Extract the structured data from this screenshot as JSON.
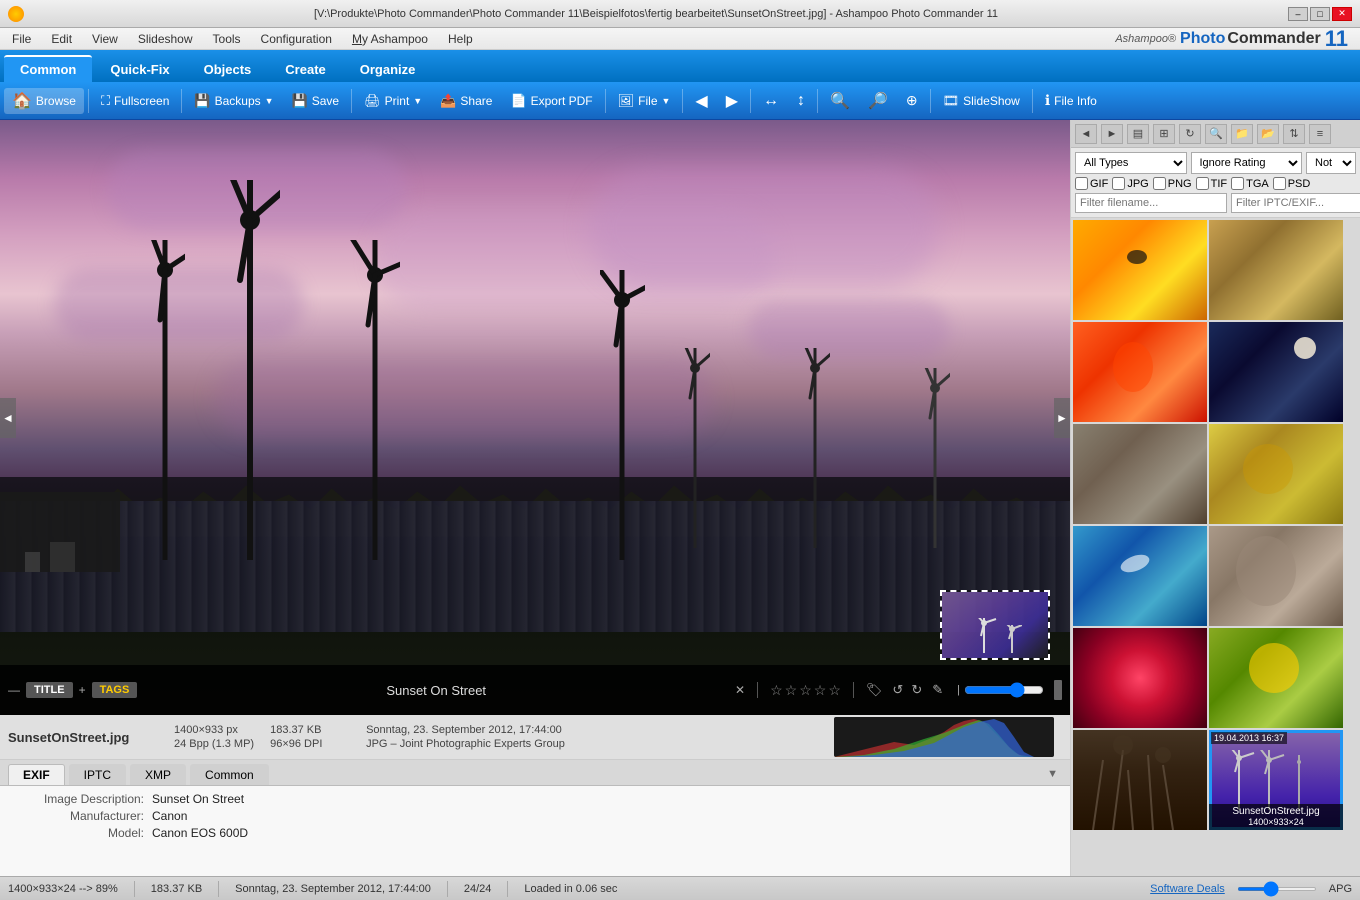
{
  "titlebar": {
    "title": "[V:\\Produkte\\Photo Commander\\Photo Commander 11\\Beispielfotos\\fertig bearbeitet\\SunsetOnStreet.jpg] - Ashampoo Photo Commander 11",
    "min": "–",
    "max": "□",
    "close": "✕"
  },
  "menubar": {
    "items": [
      "File",
      "Edit",
      "View",
      "Slideshow",
      "Tools",
      "Configuration",
      "My Ashampoo",
      "Help"
    ]
  },
  "tabs": {
    "items": [
      "Common",
      "Quick-Fix",
      "Objects",
      "Create",
      "Organize"
    ],
    "active": "Common"
  },
  "toolbar": {
    "browse": "Browse",
    "fullscreen": "Fullscreen",
    "backups": "Backups",
    "save": "Save",
    "print": "Print",
    "share": "Share",
    "exportpdf": "Export PDF",
    "file": "File",
    "prev": "◄",
    "next": "►",
    "slideshow": "SlideShow",
    "fileinfo": "File Info"
  },
  "image": {
    "title": "Sunset On Street",
    "filename": "SunsetOnStreet.jpg"
  },
  "file_info": {
    "name": "SunsetOnStreet.jpg",
    "dimensions": "1400×933 px",
    "bits": "24 Bpp (1.3 MP)",
    "dpi": "96×96 DPI",
    "size": "183.37 KB",
    "date": "Sonntag, 23. September 2012, 17:44:00",
    "format": "JPG – Joint Photographic Experts Group"
  },
  "exif_tabs": [
    "EXIF",
    "IPTC",
    "XMP",
    "Common"
  ],
  "exif_data": [
    {
      "label": "Image Description:",
      "value": "Sunset On Street"
    },
    {
      "label": "Manufacturer:",
      "value": "Canon"
    },
    {
      "label": "Model:",
      "value": "Canon EOS 600D"
    }
  ],
  "right_panel": {
    "filter_types": "All Types",
    "filter_rating": "Ignore Rating",
    "filter_third": "Not o",
    "checkboxes": [
      "GIF",
      "JPG",
      "PNG",
      "TIF",
      "TGA",
      "PSD"
    ],
    "placeholder_filename": "Filter filename...",
    "placeholder_iptc": "Filter IPTC/EXIF..."
  },
  "thumbnails": [
    {
      "id": 1,
      "cls": "thumb-bee",
      "label": ""
    },
    {
      "id": 2,
      "cls": "thumb-wheat",
      "label": ""
    },
    {
      "id": 3,
      "cls": "thumb-flower",
      "label": ""
    },
    {
      "id": 4,
      "cls": "thumb-moon",
      "label": ""
    },
    {
      "id": 5,
      "cls": "thumb-mushroom",
      "label": ""
    },
    {
      "id": 6,
      "cls": "thumb-bird",
      "label": ""
    },
    {
      "id": 7,
      "cls": "thumb-seagull",
      "label": ""
    },
    {
      "id": 8,
      "cls": "thumb-dog",
      "label": ""
    },
    {
      "id": 9,
      "cls": "thumb-rose",
      "label": ""
    },
    {
      "id": 10,
      "cls": "thumb-sunflower",
      "label": ""
    },
    {
      "id": 11,
      "cls": "thumb-grass",
      "label": ""
    },
    {
      "id": 12,
      "cls": "thumb-turbine",
      "label": "SunsetOnStreet.jpg",
      "date": "19.04.2013 16:37",
      "date2": "1400×933×24",
      "selected": true
    }
  ],
  "statusbar": {
    "dimensions": "1400×933×24 --> 89%",
    "size": "183.37 KB",
    "date": "Sonntag, 23. September 2012, 17:44:00",
    "count": "24/24",
    "loaded": "Loaded in 0.06 sec",
    "ads": "Software Deals",
    "zoom_label": "APG"
  }
}
